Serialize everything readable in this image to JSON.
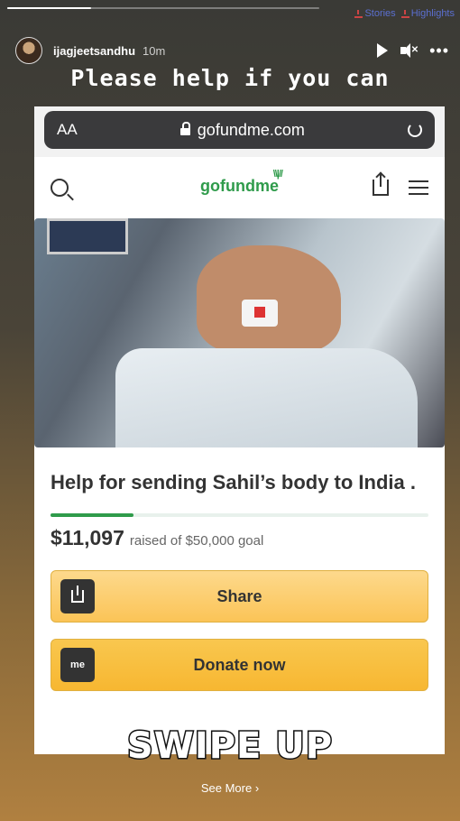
{
  "story": {
    "progress_fraction": 0.27,
    "top_links": [
      "Stories",
      "Highlights"
    ],
    "username": "ijagjeetsandhu",
    "time": "10m",
    "caption": "Please help if you can"
  },
  "browser": {
    "aa_label": "AA",
    "url": "gofundme.com"
  },
  "gofundme": {
    "logo": "gofundme",
    "campaign_title": "Help for sending Sahil’s body to India .",
    "amount_raised": "$11,097",
    "goal_text": "raised of $50,000 goal",
    "goal_fraction": 0.22,
    "share_label": "Share",
    "donate_label": "Donate now",
    "donate_icon_text": "me",
    "accent": "#2f9b4b",
    "button_color": "#fbc457"
  },
  "overlay": {
    "swipe_up": "SWIPE UP",
    "see_more": "See More"
  }
}
